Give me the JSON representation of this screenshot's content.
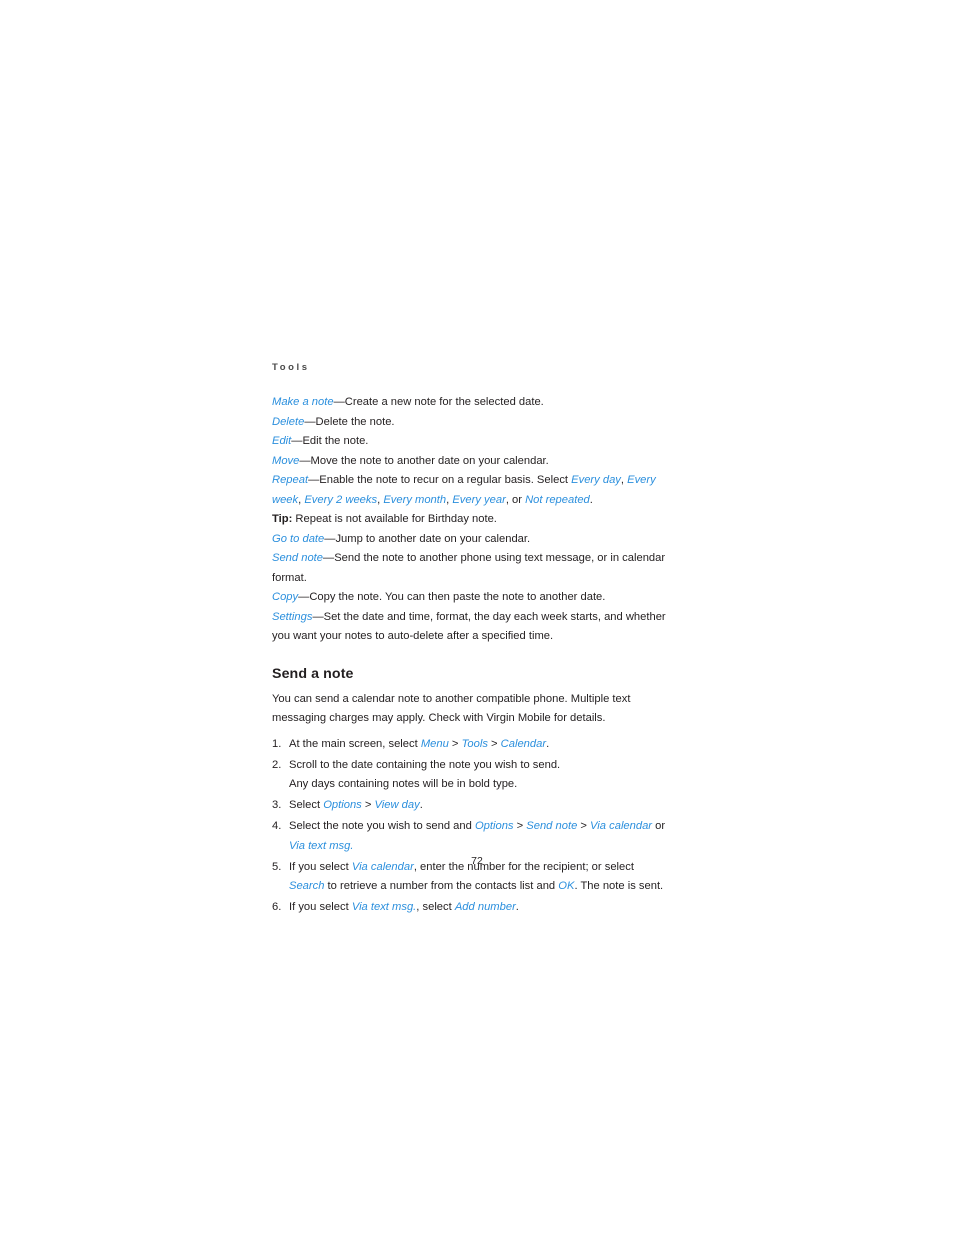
{
  "page": {
    "running_head": "Tools",
    "folio": "72",
    "link_color": "#2b8fdd",
    "text_color": "#231f20"
  },
  "definitions": [
    {
      "term": "Make a note",
      "dash": "—",
      "desc": "Create a new note for the selected date."
    },
    {
      "term": "Delete",
      "dash": "—",
      "desc": "Delete the note."
    },
    {
      "term": "Edit",
      "dash": "—",
      "desc": "Edit the note."
    },
    {
      "term": "Move",
      "dash": "—",
      "desc": "Move the note to another date on your calendar."
    },
    {
      "term": "Repeat",
      "dash": "—",
      "desc_before": "Enable the note to recur on a regular basis. Select ",
      "options": [
        "Every day",
        "Every week",
        "Every 2 weeks",
        "Every month",
        "Every year",
        "Not repeated"
      ],
      "conjunction": "or",
      "desc_after": "."
    }
  ],
  "tip": {
    "label": "Tip:",
    "text": "Repeat is not available for Birthday note."
  },
  "definitions2": [
    {
      "term": "Go to date",
      "dash": "—",
      "desc": "Jump to another date on your calendar."
    },
    {
      "term": "Send note",
      "dash": "—",
      "desc": "Send the note to another phone using text message, or in calendar format."
    },
    {
      "term": "Copy",
      "dash": "—",
      "desc": "Copy the note. You can then paste the note to another date."
    },
    {
      "term": "Settings",
      "dash": "—",
      "desc": "Set the date and time, format, the day each week starts, and whether you want your notes to auto-delete after a specified time."
    }
  ],
  "section": {
    "heading": "Send a note",
    "intro": "You can send a calendar note to another compatible phone. Multiple text messaging charges may apply. Check with Virgin Mobile for details."
  },
  "steps": {
    "s1": {
      "num": "1.",
      "pre": "At the main screen, select ",
      "t1": "Menu",
      "sep1": " > ",
      "t2": "Tools",
      "sep2": " > ",
      "t3": "Calendar",
      "post": "."
    },
    "s2": {
      "num": "2.",
      "text": "Scroll to the date containing the note you wish to send.",
      "sub": "Any days containing notes will be in bold type."
    },
    "s3": {
      "num": "3.",
      "pre": "Select ",
      "t1": "Options",
      "sep1": " > ",
      "t2": "View day",
      "post": "."
    },
    "s4": {
      "num": "4.",
      "pre": "Select the note you wish to send and ",
      "t1": "Options",
      "sep1": " > ",
      "t2": "Send note",
      "sep2": " > ",
      "t3": "Via calendar",
      "mid": " or ",
      "t4": "Via text msg."
    },
    "s5": {
      "num": "5.",
      "pre": "If you select ",
      "t1": "Via calendar",
      "mid1": ", enter the number for the recipient; or select ",
      "t2": "Search",
      "mid2": " to retrieve a number from the contacts list and ",
      "t3": "OK",
      "post": ". The note is sent."
    },
    "s6": {
      "num": "6.",
      "pre": "If you select ",
      "t1": "Via text msg.",
      "mid": ", select ",
      "t2": "Add number",
      "post": "."
    }
  }
}
